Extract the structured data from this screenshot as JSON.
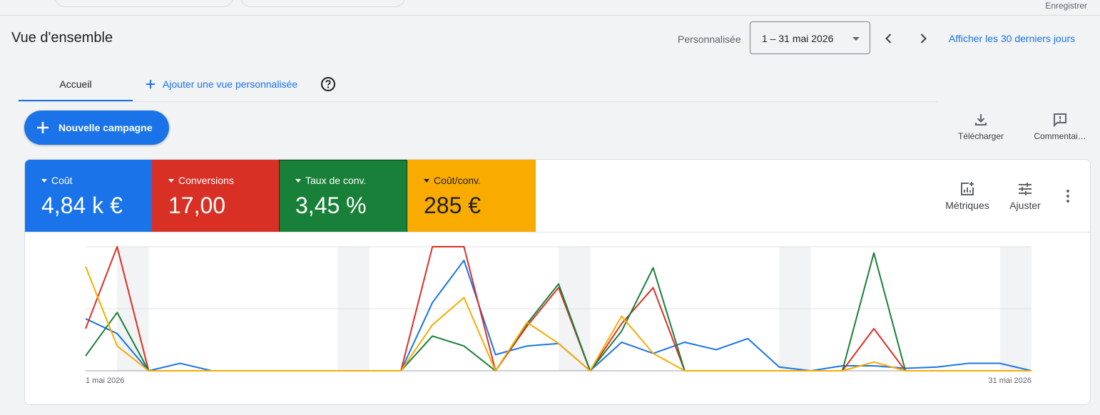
{
  "header": {
    "save_label": "Enregistrer",
    "page_title": "Vue d'ensemble",
    "range_type_label": "Personnalisée",
    "date_range_value": "1 – 31 mai 2026",
    "last_30_days_link": "Afficher les 30 derniers jours"
  },
  "tabs": {
    "home_label": "Accueil",
    "add_view_label": "Ajouter une vue personnalisée"
  },
  "actions": {
    "new_campaign_label": "Nouvelle campagne",
    "download_label": "Télécharger",
    "comments_label": "Commentai…"
  },
  "metrics": [
    {
      "name": "Coût",
      "value": "4,84 k €",
      "color": "#1a73e8"
    },
    {
      "name": "Conversions",
      "value": "17,00",
      "color": "#d93025"
    },
    {
      "name": "Taux de conv.",
      "value": "3,45 %",
      "color": "#188038"
    },
    {
      "name": "Coût/conv.",
      "value": "285 €",
      "color": "#f9ab00"
    }
  ],
  "card_tools": {
    "metrics_label": "Métriques",
    "adjust_label": "Ajuster"
  },
  "icons": [
    "chevron-left-icon",
    "chevron-right-icon",
    "plus-icon",
    "help-icon",
    "download-icon",
    "comment-icon",
    "add-chart-icon",
    "tune-icon",
    "more-vert-icon"
  ],
  "chart_data": {
    "type": "line",
    "x_start_label": "1 mai 2026",
    "x_end_label": "31 mai 2026",
    "days": 31,
    "ylim": [
      0,
      1
    ],
    "shaded_days": [
      [
        2,
        3
      ],
      [
        9,
        10
      ],
      [
        16,
        17
      ],
      [
        23,
        24
      ],
      [
        30,
        31
      ]
    ],
    "series": [
      {
        "name": "Coût",
        "color": "#1a73e8",
        "values": [
          0.42,
          0.3,
          0.0,
          0.06,
          0.0,
          0.0,
          0.0,
          0.0,
          0.0,
          0.0,
          0.0,
          0.55,
          0.89,
          0.13,
          0.2,
          0.22,
          0.0,
          0.23,
          0.14,
          0.23,
          0.17,
          0.26,
          0.03,
          0.0,
          0.04,
          0.04,
          0.02,
          0.03,
          0.06,
          0.06,
          0.0
        ]
      },
      {
        "name": "Conversions",
        "color": "#d93025",
        "values": [
          0.34,
          1.0,
          0.0,
          0.0,
          0.0,
          0.0,
          0.0,
          0.0,
          0.0,
          0.0,
          0.0,
          1.0,
          1.0,
          0.0,
          0.36,
          0.67,
          0.0,
          0.38,
          0.67,
          0.0,
          0.0,
          0.0,
          0.0,
          0.0,
          0.0,
          0.34,
          0.0,
          0.0,
          0.0,
          0.0,
          0.0
        ]
      },
      {
        "name": "Taux de conv.",
        "color": "#188038",
        "values": [
          0.12,
          0.47,
          0.0,
          0.0,
          0.0,
          0.0,
          0.0,
          0.0,
          0.0,
          0.0,
          0.0,
          0.28,
          0.2,
          0.0,
          0.38,
          0.7,
          0.0,
          0.32,
          0.83,
          0.0,
          0.0,
          0.0,
          0.0,
          0.0,
          0.0,
          0.95,
          0.0,
          0.0,
          0.0,
          0.0,
          0.0
        ]
      },
      {
        "name": "Coût/conv.",
        "color": "#f9ab00",
        "values": [
          0.84,
          0.2,
          0.0,
          0.0,
          0.0,
          0.0,
          0.0,
          0.0,
          0.0,
          0.0,
          0.0,
          0.37,
          0.59,
          0.0,
          0.39,
          0.22,
          0.0,
          0.44,
          0.14,
          0.0,
          0.0,
          0.0,
          0.0,
          0.0,
          0.0,
          0.07,
          0.0,
          0.0,
          0.0,
          0.0,
          0.0
        ]
      }
    ]
  }
}
